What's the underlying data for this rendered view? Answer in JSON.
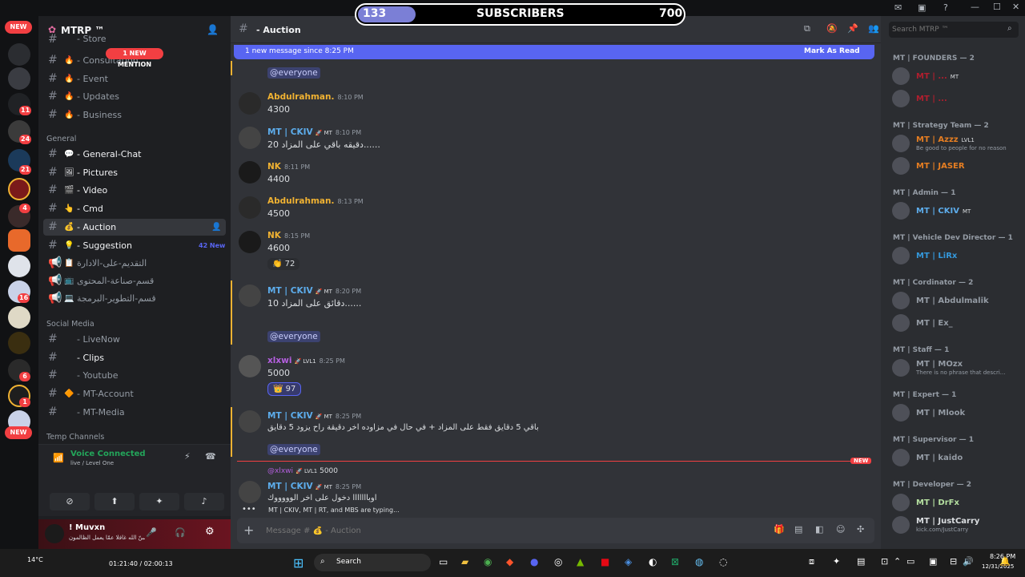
{
  "overlay": {
    "left_count": "133",
    "label": "SUBSCRIBERS",
    "right_count": "700"
  },
  "server": {
    "name": "MTRP ™",
    "new_badge": "NEW",
    "new_badge_bottom": "NEW",
    "mention_pill": "1 NEW MENTION"
  },
  "rail_badges": [
    "11",
    "24",
    "21",
    "4",
    "16",
    "6",
    "1"
  ],
  "channels": {
    "top": [
      {
        "name": "- Store",
        "emoji": ""
      },
      {
        "name": "- Consultation",
        "emoji": "🔥"
      },
      {
        "name": "- Event",
        "emoji": "🔥"
      },
      {
        "name": "- Updates",
        "emoji": "🔥"
      },
      {
        "name": "- Business",
        "emoji": "🔥"
      }
    ],
    "general_cat": "General",
    "general": [
      {
        "name": "- General-Chat",
        "emoji": "💬"
      },
      {
        "name": "- Pictures",
        "emoji": "🖼"
      },
      {
        "name": "- Video",
        "emoji": "🎬"
      },
      {
        "name": "- Cmd",
        "emoji": "👆"
      },
      {
        "name": "- Auction",
        "emoji": "💰"
      },
      {
        "name": "- Suggestion",
        "emoji": "💡",
        "badge": "42 New"
      },
      {
        "name": "التقديم-على-الادارة",
        "emoji": "📋"
      },
      {
        "name": "قسم-صناعة-المحتوى",
        "emoji": "📺"
      },
      {
        "name": "قسم-التطوير-البرمجة",
        "emoji": "💻"
      }
    ],
    "social_cat": "Social Media",
    "social": [
      {
        "name": "- LiveNow",
        "emoji": ""
      },
      {
        "name": "- Clips",
        "emoji": ""
      },
      {
        "name": "- Youtube",
        "emoji": ""
      },
      {
        "name": "- MT-Account",
        "emoji": "🔶"
      },
      {
        "name": "- MT-Media",
        "emoji": ""
      }
    ],
    "temp_cat": "Temp Channels"
  },
  "voice": {
    "status": "Voice Connected",
    "sub": "live / Level One"
  },
  "user": {
    "name": "! Muvxn",
    "status": "ولا تحسبنّ الله غافلا عمّا يعمل الظالمون"
  },
  "chat": {
    "channel": "- Auction",
    "new_banner": "1 new message since 8:25 PM",
    "mark_read": "Mark As Read",
    "composer_placeholder": "Message # 💰 - Auction",
    "typing": "MT | CKIV, MT | RT, and MBS are typing...",
    "messages": [
      {
        "type": "mention",
        "text": "@everyone"
      },
      {
        "user": "Abdulrahman.",
        "time": "8:10 PM",
        "body": "4300",
        "color": "#f0b232"
      },
      {
        "user": "MT | CKIV",
        "tag": "🚀 MT",
        "time": "8:10 PM",
        "body": "20 دقيقه باقي على المزاد......",
        "color": "#5dadec"
      },
      {
        "user": "NK",
        "time": "8:11 PM",
        "body": "4400",
        "color": "#f0b232"
      },
      {
        "user": "Abdulrahman.",
        "time": "8:13 PM",
        "body": "4500",
        "color": "#f0b232"
      },
      {
        "user": "NK",
        "time": "8:15 PM",
        "body": "4600",
        "color": "#f0b232",
        "reaction": "👏",
        "reaction_count": "72"
      },
      {
        "user": "MT | CKIV",
        "tag": "🚀 MT",
        "time": "8:20 PM",
        "body": "10 دقائق على المزاد......",
        "color": "#5dadec"
      },
      {
        "type": "mention",
        "text": "@everyone"
      },
      {
        "user": "xlxwi",
        "tag": "🚀 LVL1",
        "time": "8:25 PM",
        "body": "5000",
        "color": "#b55fe0",
        "reaction": "👑",
        "reaction_count": "97"
      },
      {
        "user": "MT | CKIV",
        "tag": "🚀 MT",
        "time": "8:25 PM",
        "body": "باقي 5 دقايق فقط على المزاد + في حال في مزاوده اخر دقيقة راح يزود 5 دقايق",
        "color": "#5dadec"
      },
      {
        "type": "mention",
        "text": "@everyone"
      },
      {
        "type": "reply",
        "user": "@xlxwi",
        "tag": "🚀 LVL1",
        "body": "5000"
      },
      {
        "user": "MT | CKIV",
        "tag": "🚀 MT",
        "time": "8:25 PM",
        "body": "اوبااااااا دخول على اخر الوووووك",
        "color": "#5dadec"
      }
    ],
    "new_marker": "NEW"
  },
  "members": {
    "search_placeholder": "Search MTRP ™",
    "groups": [
      {
        "role": "MT | FOUNDERS — 2",
        "members": [
          {
            "name": "MT | ...",
            "color": "#b01e2e",
            "tag": "MT"
          },
          {
            "name": "MT | ...",
            "color": "#b01e2e"
          }
        ]
      },
      {
        "role": "MT | Strategy Team — 2",
        "members": [
          {
            "name": "MT | Azzz",
            "color": "#e67e22",
            "tag": "LVL1",
            "sub": "Be good to people for no reason"
          },
          {
            "name": "MT | JASER",
            "color": "#e67e22"
          }
        ]
      },
      {
        "role": "MT | Admin — 1",
        "members": [
          {
            "name": "MT | CKIV",
            "color": "#5dadec",
            "tag": "MT"
          }
        ]
      },
      {
        "role": "MT | Vehicle Dev Director — 1",
        "members": [
          {
            "name": "MT | LiRx",
            "color": "#3498db"
          }
        ]
      },
      {
        "role": "MT | Cordinator — 2",
        "members": [
          {
            "name": "MT | Abdulmalik",
            "color": "#949ba4"
          },
          {
            "name": "MT | Ex_",
            "color": "#949ba4"
          }
        ]
      },
      {
        "role": "MT | Staff — 1",
        "members": [
          {
            "name": "MT | MOzx",
            "color": "#949ba4",
            "sub": "There is no phrase that descri..."
          }
        ]
      },
      {
        "role": "MT | Expert — 1",
        "members": [
          {
            "name": "MT | Mlook",
            "color": "#949ba4"
          }
        ]
      },
      {
        "role": "MT | Supervisor — 1",
        "members": [
          {
            "name": "MT | kaido",
            "color": "#949ba4"
          }
        ]
      },
      {
        "role": "MT | Developer — 2",
        "members": [
          {
            "name": "MT | DrFx",
            "color": "#b5e0a0"
          },
          {
            "name": "MT | JustCarry",
            "color": "#dbdee1",
            "sub": "kick.com/JustCarry"
          }
        ]
      }
    ]
  },
  "taskbar": {
    "temp": "14°C",
    "time_elapsed": "01:21:40 / 02:00:13",
    "search": "Search",
    "clock": "8:26 PM",
    "date": "12/31/2025"
  }
}
